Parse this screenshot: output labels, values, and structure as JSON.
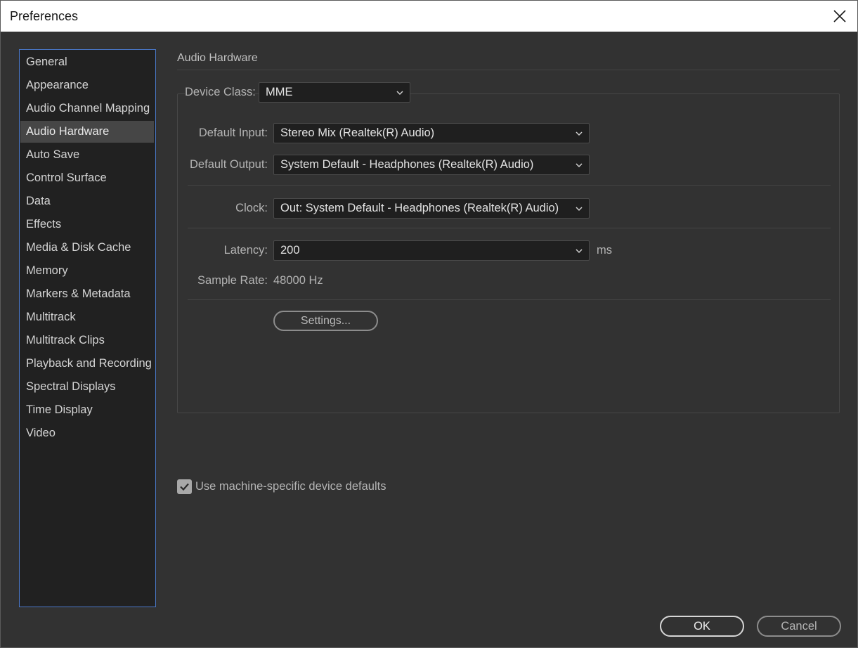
{
  "window": {
    "title": "Preferences"
  },
  "sidebar": {
    "selected": "Audio Hardware",
    "items": [
      "General",
      "Appearance",
      "Audio Channel Mapping",
      "Audio Hardware",
      "Auto Save",
      "Control Surface",
      "Data",
      "Effects",
      "Media & Disk Cache",
      "Memory",
      "Markers & Metadata",
      "Multitrack",
      "Multitrack Clips",
      "Playback and Recording",
      "Spectral Displays",
      "Time Display",
      "Video"
    ]
  },
  "panel": {
    "title": "Audio Hardware",
    "device_class": {
      "label": "Device Class:",
      "value": "MME"
    },
    "default_input": {
      "label": "Default Input:",
      "value": "Stereo Mix (Realtek(R) Audio)"
    },
    "default_output": {
      "label": "Default Output:",
      "value": "System Default - Headphones (Realtek(R) Audio)"
    },
    "clock": {
      "label": "Clock:",
      "value": "Out: System Default - Headphones (Realtek(R) Audio)"
    },
    "latency": {
      "label": "Latency:",
      "value": "200",
      "unit": "ms"
    },
    "sample_rate": {
      "label": "Sample Rate:",
      "value": "48000 Hz"
    },
    "settings_button": "Settings...",
    "machine_defaults": {
      "label": "Use machine-specific device defaults",
      "checked": true
    }
  },
  "buttons": {
    "ok": "OK",
    "cancel": "Cancel"
  },
  "colors": {
    "selection_border": "#4a78c9",
    "selected_item_bg": "#464646",
    "checkbox": "#a8a8a8"
  },
  "icons": {
    "close": "close-icon",
    "chevron": "chevron-down-icon",
    "check": "check-icon"
  }
}
